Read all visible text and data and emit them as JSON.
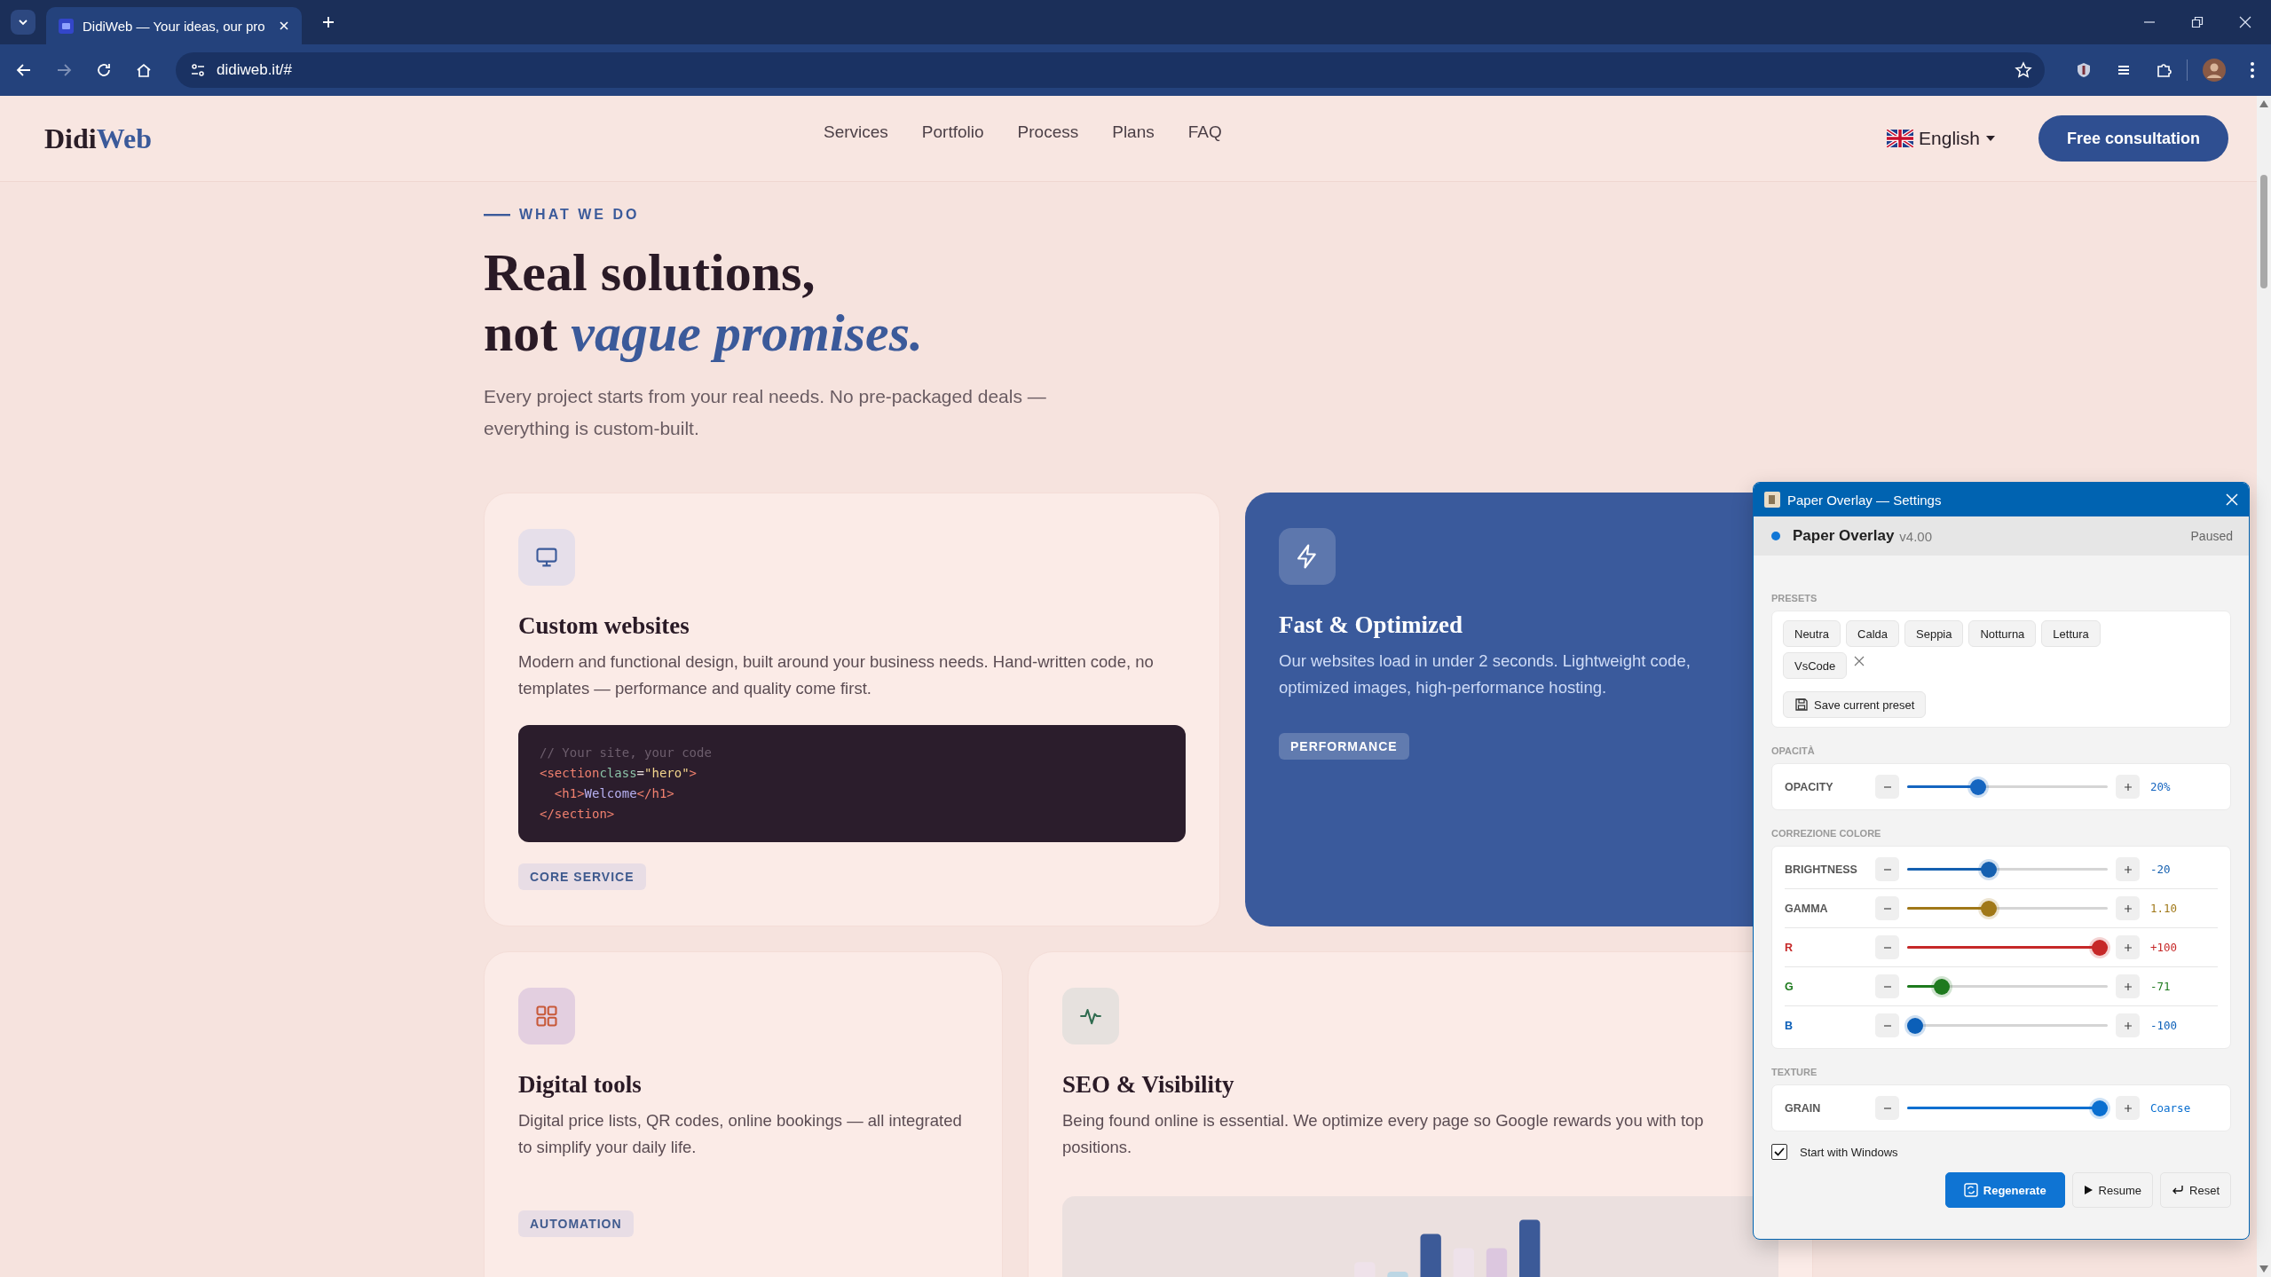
{
  "browser": {
    "tab_title": "DidiWeb — Your ideas, our pro",
    "url": "didiweb.it/#"
  },
  "site_header": {
    "logo_dark": "Didi",
    "logo_accent": "Web",
    "nav": [
      "Services",
      "Portfolio",
      "Process",
      "Plans",
      "FAQ"
    ],
    "language": "English",
    "cta": "Free consultation"
  },
  "hero": {
    "eyebrow": "WHAT WE DO",
    "title_line1": "Real solutions,",
    "title_line2": "not *vague promises.*",
    "lead": "Every project starts from your real needs. No pre-packaged deals — everything is custom-built."
  },
  "cards": [
    {
      "kind": "light",
      "title": "Custom websites",
      "text": "Modern and functional design, built around your business needs. Hand-written code, no templates — performance and quality come first.",
      "code": [
        [
          {
            "kind": "comment",
            "text": "// Your site, your code"
          }
        ],
        [
          {
            "kind": "tag",
            "text": "<section"
          },
          {
            "kind": "attr",
            "text": "class"
          },
          {
            "kind": "punct",
            "text": "="
          },
          {
            "kind": "string",
            "text": "\"hero\""
          },
          {
            "kind": "tag",
            "text": ">"
          }
        ],
        [
          {
            "kind": "tag",
            "text": "  <h1>"
          },
          {
            "kind": "text",
            "text": "Welcome"
          },
          {
            "kind": "tag",
            "text": "</h1>"
          }
        ],
        [
          {
            "kind": "tag",
            "text": "</section>"
          }
        ]
      ],
      "tag": "CORE SERVICE"
    },
    {
      "kind": "accent",
      "title": "Fast & Optimized",
      "text": "Our websites load in under 2 seconds. Lightweight code, optimized images, high-performance hosting.",
      "tag": "PERFORMANCE"
    },
    {
      "kind": "light",
      "title": "Digital tools",
      "text": "Digital price lists, QR codes, online bookings — all integrated to simplify your daily life.",
      "tag": "AUTOMATION"
    },
    {
      "kind": "light",
      "title": "SEO & Visibility",
      "text": "Being found online is essential. We optimize every page so Google rewards you with top positions."
    }
  ],
  "overlay_panel": {
    "title": "Paper Overlay — Settings",
    "app_name": "Paper Overlay",
    "version": "v4.00",
    "status": "Paused",
    "presets_label": "PRESETS",
    "presets": [
      {
        "label": "Neutra",
        "removable": false
      },
      {
        "label": "Calda",
        "removable": false
      },
      {
        "label": "Seppia",
        "removable": false
      },
      {
        "label": "Notturna",
        "removable": false
      },
      {
        "label": "Lettura",
        "removable": false
      },
      {
        "label": "VsCode",
        "removable": true
      }
    ],
    "save_preset": "Save current preset",
    "sections": [
      {
        "label": "OPACITÀ",
        "sliders": [
          {
            "name": "OPACITY",
            "kind": "adjust",
            "color": "#1565c0",
            "level": 0.34,
            "reading": "20%"
          }
        ]
      },
      {
        "label": "CORREZIONE COLORE",
        "sliders": [
          {
            "name": "BRIGHTNESS",
            "kind": "adjust",
            "color": "#1560b0",
            "level": 0.4,
            "reading": "-20"
          },
          {
            "name": "GAMMA",
            "kind": "adjust",
            "color": "#a07818",
            "level": 0.4,
            "reading": "1.10"
          },
          {
            "name": "R",
            "kind": "channel",
            "color": "#c62828",
            "level": 1.0,
            "reading": "+100"
          },
          {
            "name": "G",
            "kind": "channel",
            "color": "#1e7a1e",
            "level": 0.145,
            "reading": "-71"
          },
          {
            "name": "B",
            "kind": "channel",
            "color": "#0b5fb8",
            "level": 0.0,
            "reading": "-100"
          }
        ]
      },
      {
        "label": "TEXTURE",
        "sliders": [
          {
            "name": "GRAIN",
            "kind": "adjust",
            "color": "#0a6fd0",
            "level": 1.0,
            "reading": "Coarse"
          }
        ]
      }
    ],
    "start_with_windows": {
      "label": "Start with Windows",
      "checked": true
    },
    "buttons": [
      {
        "label": "Regenerate",
        "kind": "primary"
      },
      {
        "label": "Resume",
        "kind": "play"
      },
      {
        "label": "Reset",
        "kind": "reset"
      }
    ]
  }
}
